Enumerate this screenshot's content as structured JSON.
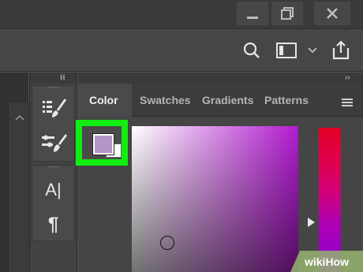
{
  "toolbar": {
    "icons": [
      "search-icon",
      "workspace-icon",
      "chevron-down-icon",
      "share-icon"
    ]
  },
  "window_controls": [
    "minimize-icon",
    "restore-icon",
    "close-icon"
  ],
  "panel_collapse": {
    "left_label": "‹‹",
    "right_label": "››"
  },
  "tools_column": {
    "collapse_label": "‹‹",
    "groups": [
      {
        "tools": [
          "properties-icon",
          "brush-icon"
        ]
      },
      {
        "tools": [
          "brush-settings-icon"
        ]
      },
      {
        "tools": [
          {
            "icon": "character-icon",
            "label": "A|"
          },
          {
            "icon": "paragraph-icon",
            "label": "¶"
          }
        ]
      }
    ]
  },
  "panel": {
    "tabs": [
      {
        "label": "Color",
        "active": true
      },
      {
        "label": "Swatches",
        "active": false
      },
      {
        "label": "Gradients",
        "active": false
      },
      {
        "label": "Patterns",
        "active": false
      }
    ],
    "menu_icon": "hamburger-menu-icon"
  },
  "color": {
    "foreground": "#b496c8",
    "background": "#ffffff",
    "hue_top": "#e00024",
    "field_hue": "#b21bd0",
    "highlight": "#11ee11"
  },
  "watermark": {
    "text": "wikiHow"
  }
}
